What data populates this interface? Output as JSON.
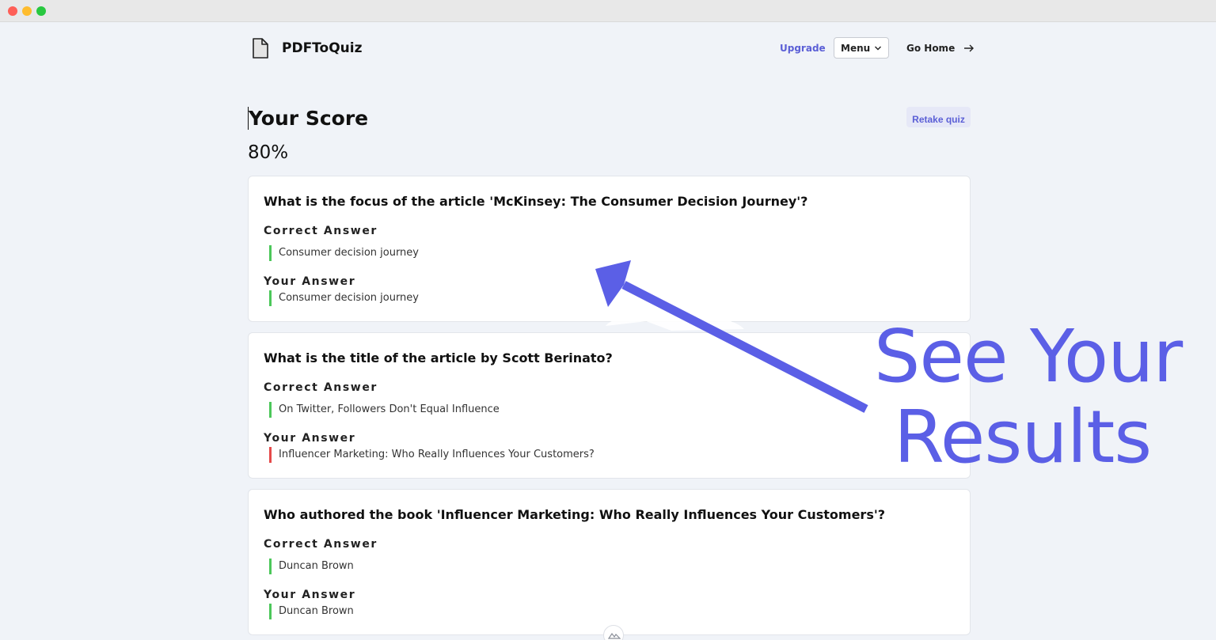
{
  "window": {
    "controls": [
      "close",
      "minimize",
      "maximize"
    ]
  },
  "nav": {
    "logo_icon": "document-icon",
    "brand": "PDFToQuiz",
    "upgrade": "Upgrade",
    "menu": "Menu",
    "go_home": "Go Home"
  },
  "score": {
    "title": "Your Score",
    "value": "80%",
    "retake": "Retake quiz"
  },
  "questions": [
    {
      "question": "What is the focus of the article 'McKinsey: The Consumer Decision Journey'?",
      "correct_label": "Correct Answer",
      "correct": "Consumer decision journey",
      "your_label": "Your Answer",
      "your": "Consumer decision journey",
      "is_correct": true
    },
    {
      "question": "What is the title of the article by Scott Berinato?",
      "correct_label": "Correct Answer",
      "correct": "On Twitter, Followers Don't Equal Influence",
      "your_label": "Your Answer",
      "your": "Influencer Marketing: Who Really Influences Your Customers?",
      "is_correct": false
    },
    {
      "question": "Who authored the book 'Influencer Marketing: Who Really Influences Your Customers'?",
      "correct_label": "Correct Answer",
      "correct": "Duncan Brown",
      "your_label": "Your Answer",
      "your": "Duncan Brown",
      "is_correct": true
    }
  ],
  "promo": {
    "line1": "See Your",
    "line2": "Results"
  },
  "colors": {
    "accent": "#5b5fd6",
    "promo": "#5b5fe6",
    "correct_bar": "#4cc75a",
    "wrong_bar": "#e54a4a",
    "background": "#f0f3f8"
  }
}
